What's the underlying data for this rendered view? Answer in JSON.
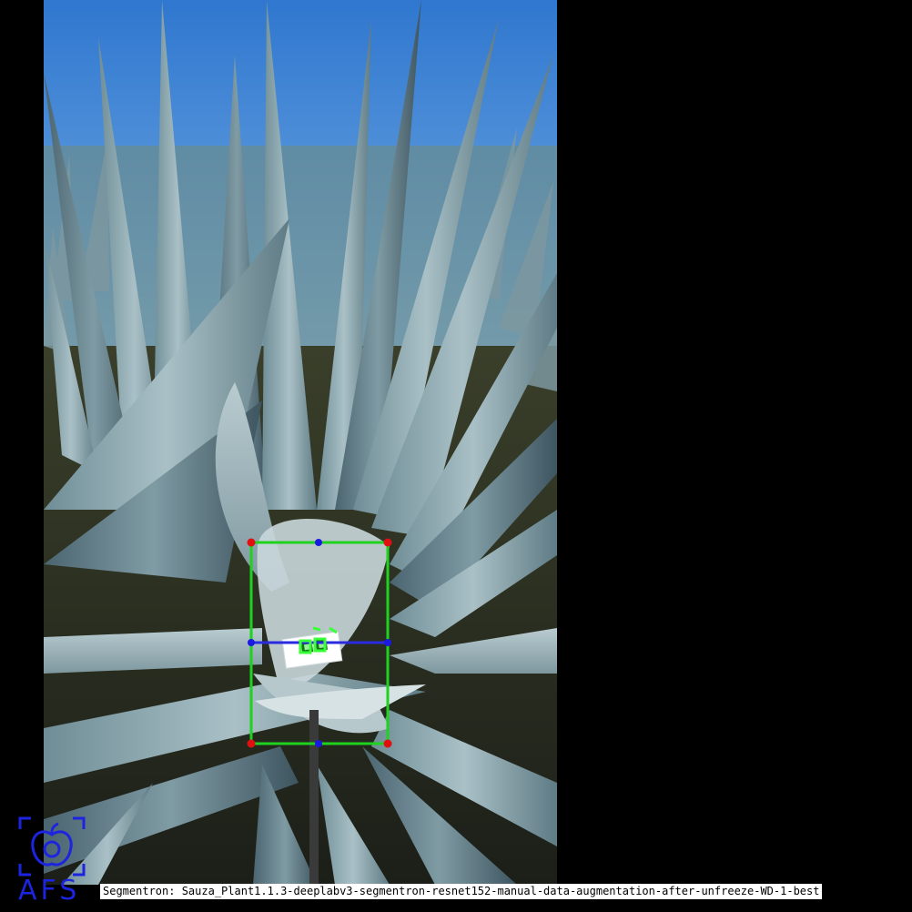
{
  "scene": {
    "subject": "agave-plant-photo",
    "sky_color": "#3c82d2",
    "leaf_color": "#8fa9b0",
    "shadow_color": "#3e5560"
  },
  "detection": {
    "box_color": "#1fd21f",
    "corner_color": "#e01010",
    "midpoint_color": "#1a1ae0",
    "marker_color": "#39ff39"
  },
  "logo": {
    "text": "AFS",
    "icon": "apple-bracket-icon",
    "color": "#1d24e0"
  },
  "caption": {
    "text": "Segmentron: Sauza_Plant1.1.3-deeplabv3-segmentron-resnet152-manual-data-augmentation-after-unfreeze-WD-1-best"
  }
}
